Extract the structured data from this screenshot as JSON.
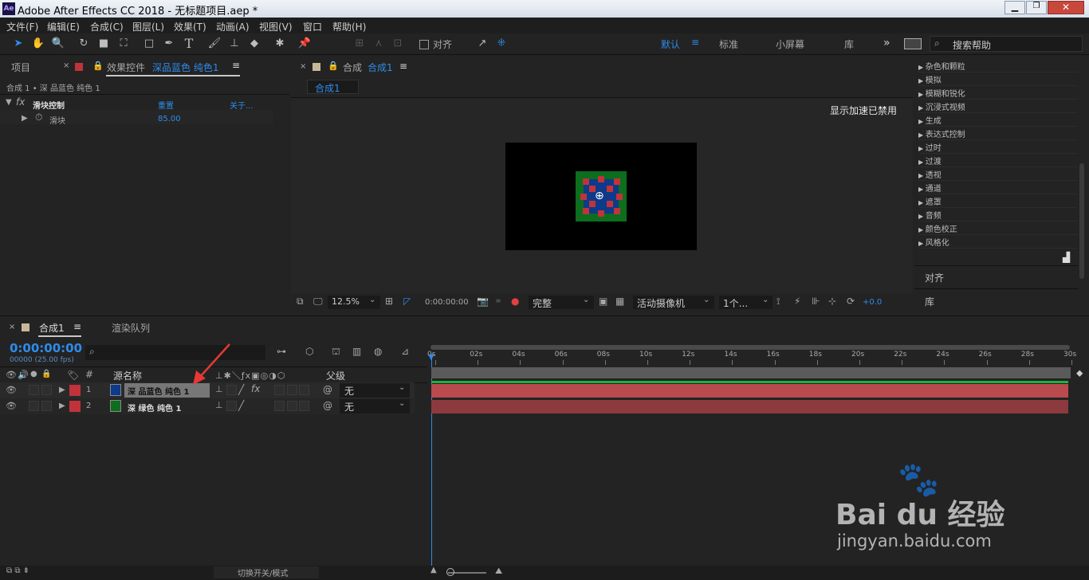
{
  "window": {
    "title": "Adobe After Effects CC 2018 - 无标题项目.aep *",
    "app_badge": "Ae"
  },
  "menu": [
    "文件(F)",
    "编辑(E)",
    "合成(C)",
    "图层(L)",
    "效果(T)",
    "动画(A)",
    "视图(V)",
    "窗口",
    "帮助(H)"
  ],
  "toolbar": {
    "snap_label": "对齐",
    "workspaces": [
      "默认",
      "标准",
      "小屏幕",
      "库"
    ],
    "search_placeholder": "搜索帮助"
  },
  "project_panel": {
    "tab_project": "项目",
    "tab_effects": "效果控件",
    "effect_target": "深品蓝色 纯色1",
    "breadcrumb": "合成 1 • 深 品蓝色 纯色 1",
    "effect": {
      "name": "滑块控制",
      "reset": "重置",
      "about": "关于...",
      "param": "滑块",
      "value": "85.00"
    }
  },
  "comp_panel": {
    "tab_label": "合成",
    "tab_name": "合成1",
    "sub_tab": "合成1",
    "notice": "显示加速已禁用",
    "footer": {
      "zoom": "12.5%",
      "timecode": "0:00:00:00",
      "quality": "完整",
      "camera": "活动摄像机",
      "views": "1个...",
      "exposure": "+0.0"
    }
  },
  "effects_list": [
    "杂色和颗粒",
    "模拟",
    "模糊和锐化",
    "沉浸式视频",
    "生成",
    "表达式控制",
    "过时",
    "过渡",
    "透视",
    "通道",
    "遮罩",
    "音频",
    "颜色校正",
    "风格化"
  ],
  "right_panels": [
    "对齐",
    "库"
  ],
  "timeline": {
    "tab": "合成1",
    "render_tab": "渲染队列",
    "timecode": "0:00:00:00",
    "fps": "00000 (25.00 fps)",
    "col_source": "源名称",
    "col_parent": "父级",
    "col_num": "#",
    "layers": [
      {
        "num": "1",
        "name": "深 品蓝色 纯色 1",
        "color": "#0d3a8a",
        "parent": "无"
      },
      {
        "num": "2",
        "name": "深 绿色 纯色 1",
        "color": "#0d6e1e",
        "parent": "无"
      }
    ],
    "ruler": [
      "0s",
      "02s",
      "04s",
      "06s",
      "08s",
      "10s",
      "12s",
      "14s",
      "16s",
      "18s",
      "20s",
      "22s",
      "24s",
      "26s",
      "28s",
      "30s"
    ],
    "footer_toggle": "切换开关/模式"
  },
  "watermark": {
    "text": "Bai du 经验",
    "url": "jingyan.baidu.com"
  }
}
